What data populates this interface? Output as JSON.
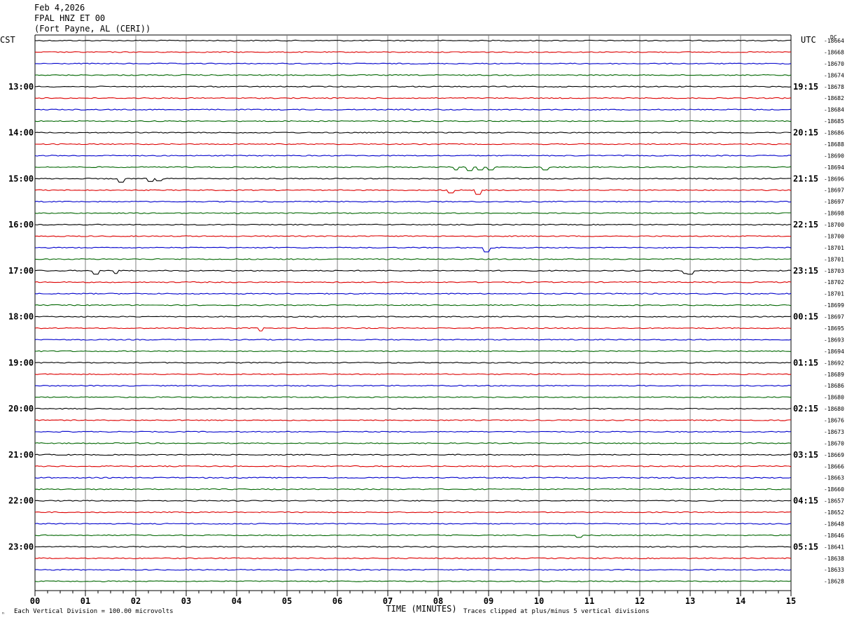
{
  "header": {
    "date": "Feb 4,2026",
    "station": "FPAL HNZ ET 00",
    "location": "(Fort Payne, AL (CERI))"
  },
  "left_timezone": "CST",
  "right_timezone": "UTC",
  "dc_label": "DC",
  "footer": {
    "scale_note": "Each Vertical Division =  100.00 microvolts",
    "clip_note": "Traces clipped at plus/minus 5 vertical divisions",
    "mark": "ⁿ"
  },
  "colors": {
    "black": "#000000",
    "red": "#dd0000",
    "blue": "#0000cc",
    "green": "#006600",
    "grid": "#808080"
  },
  "chart_data": {
    "type": "line",
    "title": "FPAL HNZ ET 00",
    "xlabel": "TIME (MINUTES)",
    "x_ticks": [
      "00",
      "01",
      "02",
      "03",
      "04",
      "05",
      "06",
      "07",
      "08",
      "09",
      "10",
      "11",
      "12",
      "13",
      "14",
      "15"
    ],
    "x_range": [
      0,
      15
    ],
    "left_hour_labels": [
      "13:00",
      "14:00",
      "15:00",
      "16:00",
      "17:00",
      "18:00",
      "19:00",
      "20:00",
      "21:00",
      "22:00",
      "23:00"
    ],
    "right_hour_labels": [
      "19:15",
      "20:15",
      "21:15",
      "22:15",
      "23:15",
      "00:15",
      "01:15",
      "02:15",
      "03:15",
      "04:15",
      "05:15"
    ],
    "trace_color_cycle": [
      "black",
      "red",
      "blue",
      "green"
    ],
    "dc_offsets": [
      -18664,
      -18668,
      -18670,
      -18674,
      -18678,
      -18682,
      -18684,
      -18685,
      -18686,
      -18688,
      -18690,
      -18694,
      -18696,
      -18697,
      -18697,
      -18698,
      -18700,
      -18700,
      -18701,
      -18701,
      -18703,
      -18702,
      -18701,
      -18699,
      -18697,
      -18695,
      -18693,
      -18694,
      -18692,
      -18689,
      -18686,
      -18680,
      -18680,
      -18676,
      -18673,
      -18670,
      -18669,
      -18666,
      -18663,
      -18660,
      -18657,
      -18652,
      -18648,
      -18646,
      -18641,
      -18638,
      -18633,
      -18628
    ],
    "events": [
      {
        "trace": 12,
        "x_min": 1.72,
        "depth": 5
      },
      {
        "trace": 12,
        "x_min": 2.3,
        "depth": 4
      },
      {
        "trace": 12,
        "x_min": 2.45,
        "depth": 3
      },
      {
        "trace": 11,
        "x_min": 8.35,
        "depth": 4
      },
      {
        "trace": 11,
        "x_min": 8.62,
        "depth": 5
      },
      {
        "trace": 11,
        "x_min": 8.82,
        "depth": 4
      },
      {
        "trace": 11,
        "x_min": 9.05,
        "depth": 4
      },
      {
        "trace": 11,
        "x_min": 10.12,
        "depth": 4
      },
      {
        "trace": 13,
        "x_min": 8.25,
        "depth": 4
      },
      {
        "trace": 13,
        "x_min": 8.78,
        "depth": 6
      },
      {
        "trace": 18,
        "x_min": 8.95,
        "depth": 6
      },
      {
        "trace": 20,
        "x_min": 1.22,
        "depth": 5
      },
      {
        "trace": 20,
        "x_min": 1.6,
        "depth": 4
      },
      {
        "trace": 20,
        "x_min": 12.9,
        "depth": 4
      },
      {
        "trace": 20,
        "x_min": 13.0,
        "depth": 5
      },
      {
        "trace": 25,
        "x_min": 4.48,
        "depth": 4
      },
      {
        "trace": 43,
        "x_min": 10.78,
        "depth": 3
      }
    ]
  }
}
